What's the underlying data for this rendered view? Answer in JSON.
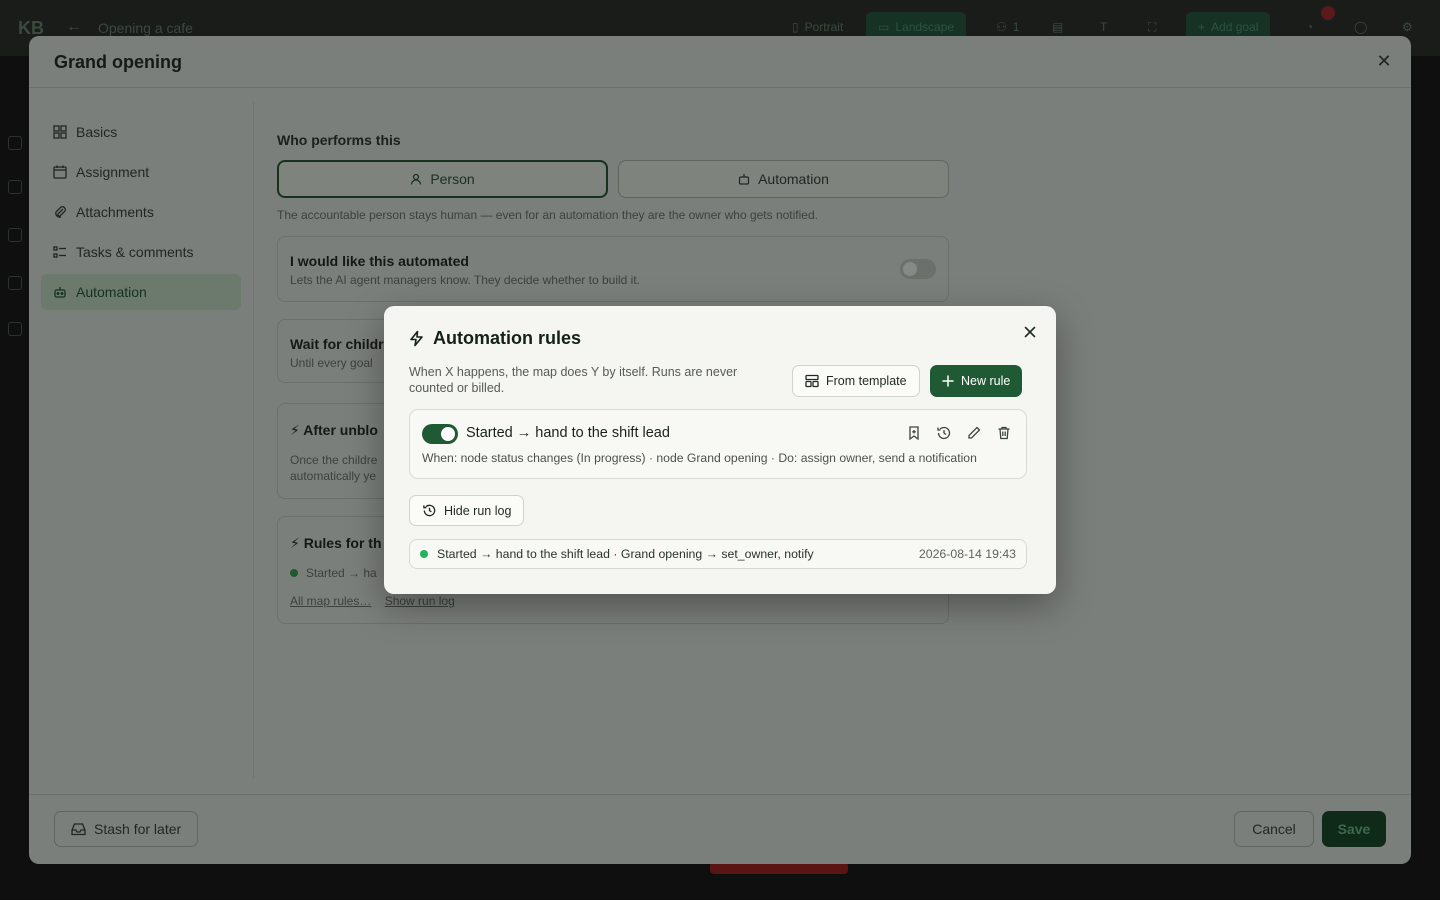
{
  "background": {
    "logo": "KB",
    "crumb": "Opening a cafe",
    "portrait_label": "Portrait",
    "landscape_label": "Landscape",
    "people_count": "1",
    "add_goal_label": "Add goal"
  },
  "modal": {
    "title": "Grand opening",
    "nav": [
      {
        "label": "Basics",
        "icon": "grid-icon"
      },
      {
        "label": "Assignment",
        "icon": "calendar-icon"
      },
      {
        "label": "Attachments",
        "icon": "paperclip-icon"
      },
      {
        "label": "Tasks & comments",
        "icon": "list-icon"
      },
      {
        "label": "Automation",
        "icon": "robot-icon"
      }
    ],
    "performer": {
      "label": "Who performs this",
      "person": "Person",
      "automation": "Automation",
      "helper": "The accountable person stays human — even for an automation they are the owner who gets notified."
    },
    "cards": {
      "automated_title": "I would like this automated",
      "automated_sub": "Lets the AI agent managers know. They decide whether to build it.",
      "wait_title": "Wait for childr",
      "wait_sub": "Until every goal",
      "unblock_title": "After unblo",
      "unblock_sub1": "Once the childre",
      "unblock_sub2": "automatically ye",
      "rules_title": "Rules for th",
      "rules_item": "Started → ha",
      "all_rules_link": "All map rules…",
      "show_log_link": "Show run log"
    },
    "footer": {
      "stash": "Stash for later",
      "cancel": "Cancel",
      "save": "Save"
    }
  },
  "dialog": {
    "title": "Automation rules",
    "description": "When X happens, the map does Y by itself. Runs are never counted or billed.",
    "from_template": "From template",
    "new_rule": "New rule",
    "rule": {
      "enabled": true,
      "name": "Started → hand to the shift lead",
      "description": "When: node status changes (In progress) · node Grand opening · Do: assign owner, send a notification"
    },
    "hide_log": "Hide run log",
    "log": [
      {
        "text": "Started → hand to the shift lead · Grand opening → set_owner, notify",
        "time": "2026-08-14 19:43",
        "status_color": "#22b35c"
      }
    ]
  },
  "colors": {
    "accent": "#1f5a35",
    "success": "#22b35c"
  }
}
